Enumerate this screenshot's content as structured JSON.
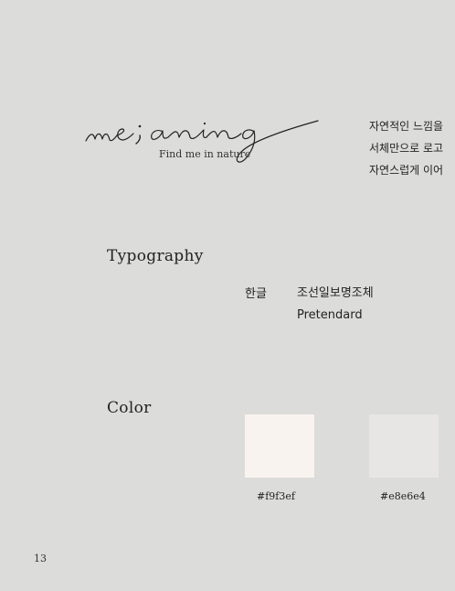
{
  "logo": {
    "wordmark": "me;aning",
    "tagline": "Find me in nature"
  },
  "description": {
    "lines": [
      "자연적인 느낌을",
      "서체만으로 로고",
      "자연스럽게 이어"
    ]
  },
  "typography": {
    "title": "Typography",
    "label": "한글",
    "korean_font": "조선일보명조체",
    "latin_font": "Pretendard"
  },
  "color": {
    "title": "Color",
    "swatches": [
      {
        "hex": "#f9f3ef",
        "label": "#f9f3ef"
      },
      {
        "hex": "#e8e6e4",
        "label": "#e8e6e4"
      }
    ]
  },
  "page_number": "13"
}
